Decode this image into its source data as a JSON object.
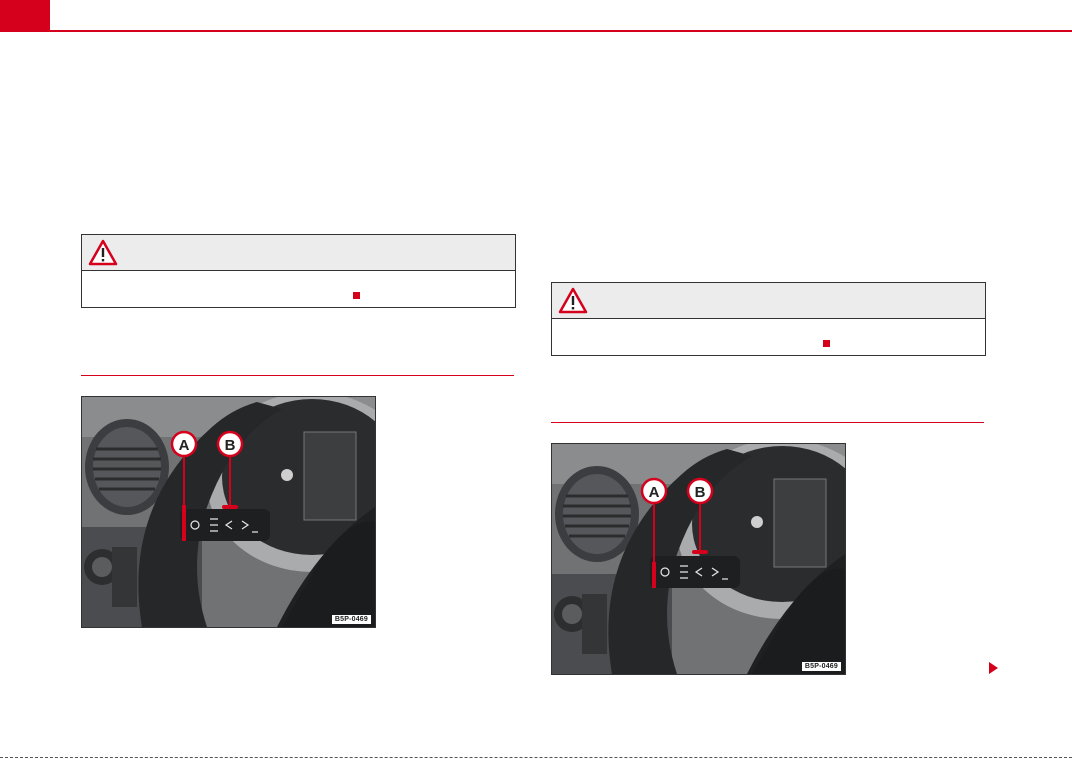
{
  "colors": {
    "accent": "#d5001c",
    "warning_header": "#ececec",
    "figure_dark": "#3a3a3a"
  },
  "icons": {
    "warning": "warning-triangle-icon",
    "end_marker": "end-square-icon",
    "continue": "continue-arrow-icon"
  },
  "figures": [
    {
      "code": "B5P-0469",
      "callout_a": "A",
      "callout_b": "B"
    },
    {
      "code": "B5P-0469",
      "callout_a": "A",
      "callout_b": "B"
    }
  ]
}
